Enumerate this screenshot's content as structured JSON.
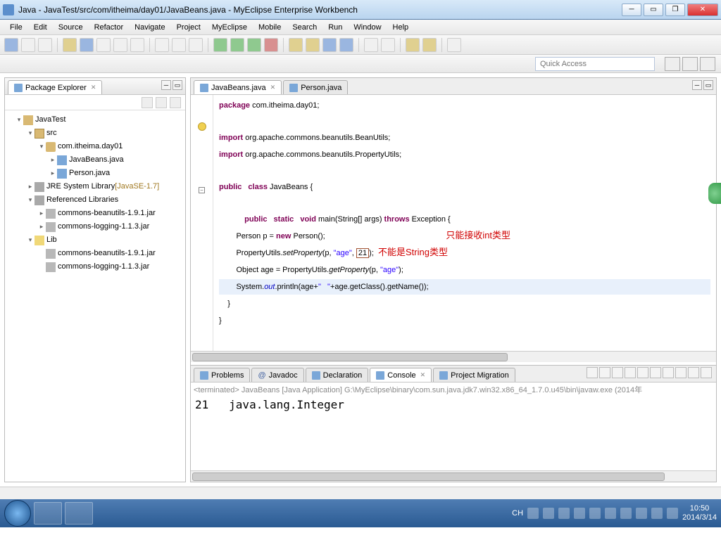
{
  "window": {
    "title": "Java - JavaTest/src/com/itheima/day01/JavaBeans.java - MyEclipse Enterprise Workbench"
  },
  "menu": {
    "file": "File",
    "edit": "Edit",
    "source": "Source",
    "refactor": "Refactor",
    "navigate": "Navigate",
    "project": "Project",
    "myeclipse": "MyEclipse",
    "mobile": "Mobile",
    "search": "Search",
    "run": "Run",
    "window": "Window",
    "help": "Help"
  },
  "quick": {
    "placeholder": "Quick Access"
  },
  "pkgexplorer": {
    "title": "Package Explorer",
    "project": "JavaTest",
    "src": "src",
    "pkg": "com.itheima.day01",
    "file1": "JavaBeans.java",
    "file2": "Person.java",
    "jre": "JRE System Library",
    "jreVer": "[JavaSE-1.7]",
    "reflib": "Referenced Libraries",
    "jar1": "commons-beanutils-1.9.1.jar",
    "jar2": "commons-logging-1.1.3.jar",
    "lib": "Lib",
    "libjar1": "commons-beanutils-1.9.1.jar",
    "libjar2": "commons-logging-1.1.3.jar"
  },
  "editortabs": {
    "active": "JavaBeans.java",
    "other": "Person.java"
  },
  "code": {
    "l1_pkg": "package",
    "l1_rest": " com.itheima.day01;",
    "l3_imp": "import",
    "l3_rest": " org.apache.commons.beanutils.BeanUtils;",
    "l4_imp": "import",
    "l4_rest": " org.apache.commons.beanutils.PropertyUtils;",
    "l6_pub": "public",
    "l6_cls": "class",
    "l6_name": " JavaBeans {",
    "l8_pub": "public",
    "l8_stat": "static",
    "l8_void": "void",
    "l8_main": " main(String[] args) ",
    "l8_throw": "throws",
    "l8_exc": " Exception {",
    "l9a": "        Person p = ",
    "l9_new": "new",
    "l9b": " Person();",
    "ann1": "只能接收int类型",
    "l10a": "        PropertyUtils.",
    "l10_set": "setProperty",
    "l10b": "(p, ",
    "l10_age": "\"age\"",
    "l10c": ", ",
    "l10_21": "21",
    "l10d": ");  ",
    "ann2": "不能是String类型",
    "l11a": "        Object age = PropertyUtils.",
    "l11_get": "getProperty",
    "l11b": "(p, ",
    "l11_age": "\"age\"",
    "l11c": ");",
    "l12a": "        System.",
    "l12_out": "out",
    "l12b": ".println(age+",
    "l12_s": "\"   \"",
    "l12c": "+age.getClass().getName());",
    "l13": "    }",
    "l14": "}"
  },
  "bottomtabs": {
    "problems": "Problems",
    "javadoc": "Javadoc",
    "decl": "Declaration",
    "console": "Console",
    "proj": "Project Migration"
  },
  "console": {
    "hdr": "<terminated> JavaBeans [Java Application] G:\\MyEclipse\\binary\\com.sun.java.jdk7.win32.x86_64_1.7.0.u45\\bin\\javaw.exe (2014年",
    "out": "21   java.lang.Integer"
  },
  "tray": {
    "ime": "CH",
    "time": "10:50",
    "date": "2014/3/14"
  }
}
